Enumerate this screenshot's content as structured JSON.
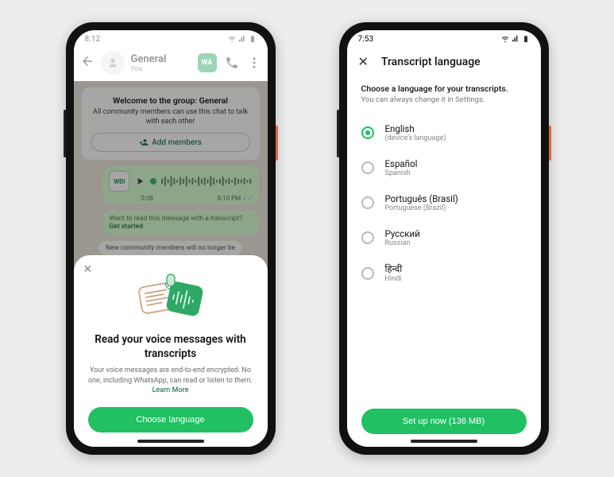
{
  "left": {
    "status_time": "8:12",
    "chat": {
      "name": "General",
      "subtitle": "You",
      "brand_badge": "WA"
    },
    "welcome": {
      "title": "Welcome to the group: General",
      "body": "All community members can use this chat to talk with each other",
      "add_members": "Add members"
    },
    "voice": {
      "avatar": "WBI",
      "duration": "0:08",
      "time": "8:10 PM"
    },
    "hint": {
      "line": "Want to read this message with a transcript?",
      "link": "Get started"
    },
    "sys_msg": "New community members will no longer be",
    "sheet": {
      "title": "Read your voice messages with transcripts",
      "body": "Your voice messages are end-to-end encrypted. No one, including WhatsApp, can read or listen to them.",
      "learn_more": "Learn More",
      "button": "Choose language"
    }
  },
  "right": {
    "status_time": "7:53",
    "header": "Transcript language",
    "lead": "Choose a language for your transcripts.",
    "sub": "You can always change it in Settings.",
    "languages": [
      {
        "primary": "English",
        "secondary": "(device's language)",
        "selected": true
      },
      {
        "primary": "Español",
        "secondary": "Spanish",
        "selected": false
      },
      {
        "primary": "Português (Brasil)",
        "secondary": "Portuguese (Brazil)",
        "selected": false
      },
      {
        "primary": "Русский",
        "secondary": "Russian",
        "selected": false
      },
      {
        "primary": "हिन्दी",
        "secondary": "Hindi",
        "selected": false
      }
    ],
    "button": "Set up now (136 MB)"
  }
}
